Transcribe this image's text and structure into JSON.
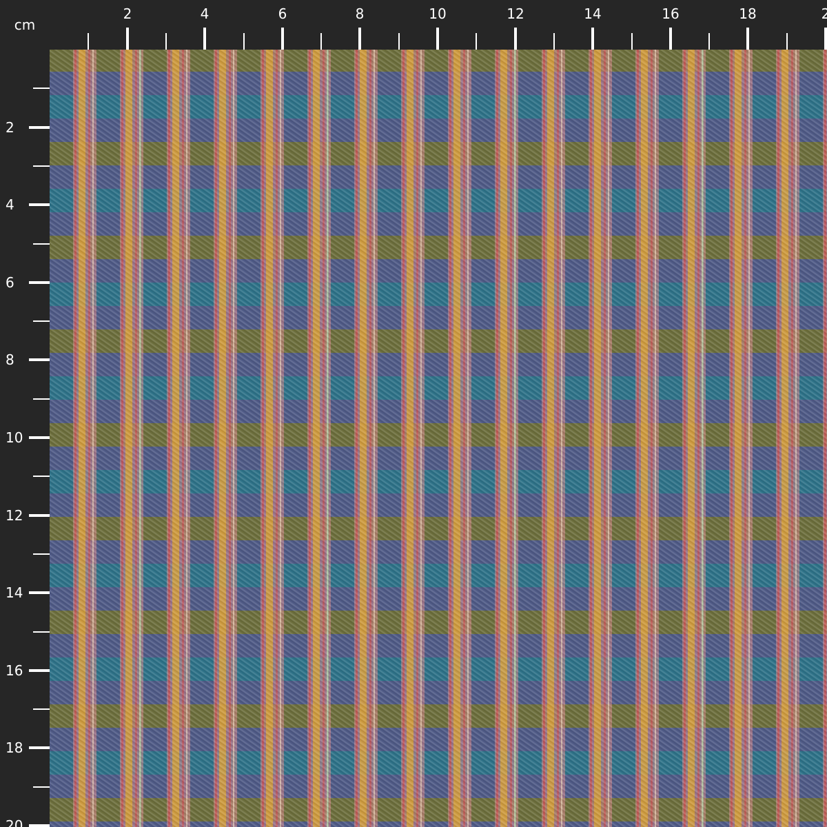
{
  "ruler": {
    "unit": "cm",
    "top_labels": [
      "2",
      "4",
      "6",
      "8",
      "10",
      "12",
      "14",
      "16",
      "18",
      "2"
    ],
    "left_labels": [
      "2",
      "4",
      "6",
      "8",
      "10",
      "12",
      "14",
      "16",
      "18",
      "20"
    ]
  },
  "fabric": {
    "pattern": "plaid",
    "colors": {
      "navy_ground": "#4f5a86",
      "teal_band": "#2c7488",
      "olive_band": "#6e7038",
      "mustard_stripe": "#d9a432",
      "pink_stripe": "#d98a8c",
      "red_stripe": "#c94d4f",
      "light_green_thread": "#9ccf9e",
      "cream_thread": "#f0dcc0"
    }
  }
}
